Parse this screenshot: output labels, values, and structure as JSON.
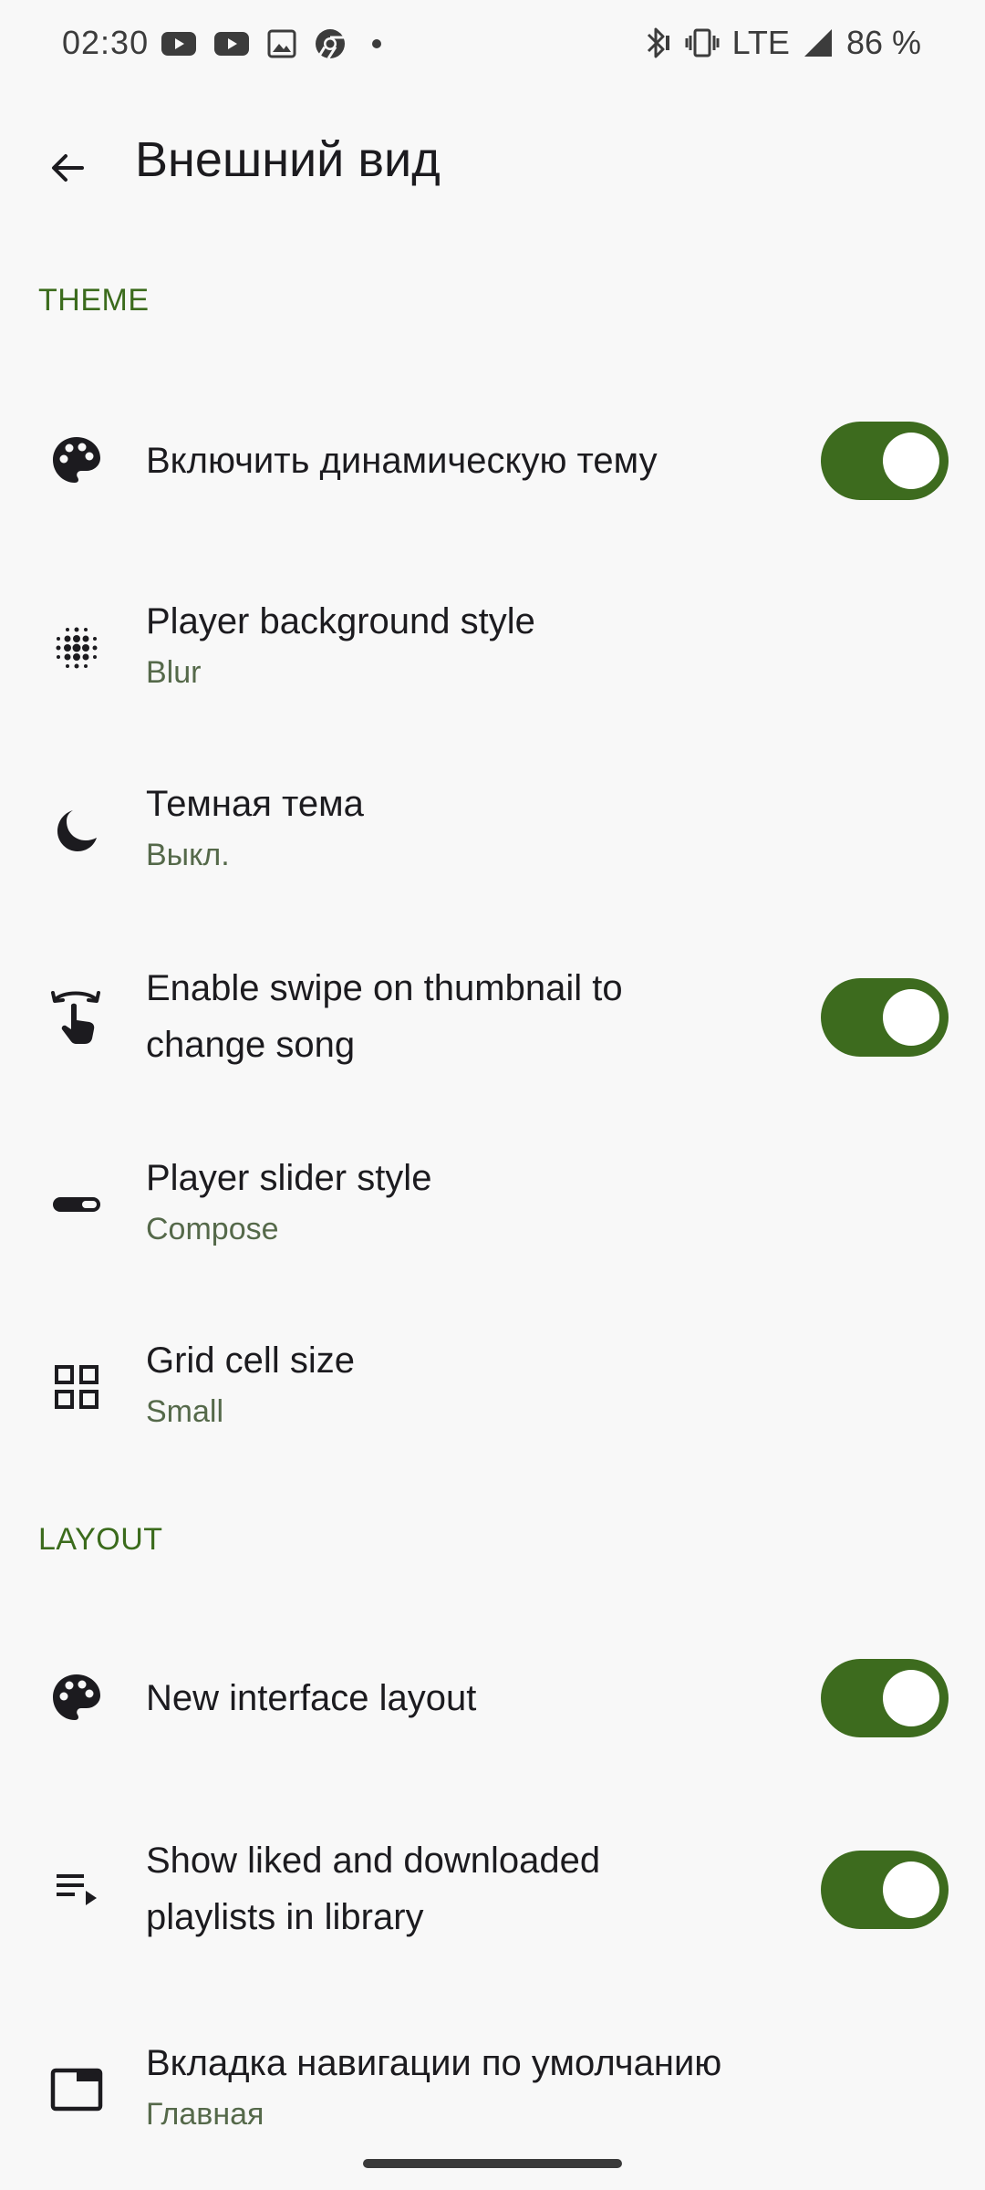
{
  "status_bar": {
    "time": "02:30",
    "network": "LTE",
    "battery": "86 %",
    "left_icons": [
      "youtube-icon",
      "youtube-icon",
      "image-icon",
      "chrome-icon",
      "dot-icon"
    ],
    "right_icons": [
      "bluetooth-icon",
      "vibrate-icon",
      "signal-icon"
    ]
  },
  "app_bar": {
    "title": "Внешний вид"
  },
  "sections": {
    "theme": "THEME",
    "layout": "LAYOUT"
  },
  "items": {
    "dynamic_theme": {
      "title": "Включить динамическую тему",
      "enabled": true,
      "icon": "palette-icon"
    },
    "player_bg": {
      "title": "Player background style",
      "value": "Blur",
      "icon": "blur-icon"
    },
    "dark_theme": {
      "title": "Темная тема",
      "value": "Выкл.",
      "icon": "moon-icon"
    },
    "swipe_thumbnail": {
      "title_line1": "Enable swipe on thumbnail to",
      "title_line2": "change song",
      "enabled": true,
      "icon": "swipe-gesture-icon"
    },
    "slider_style": {
      "title": "Player slider style",
      "value": "Compose",
      "icon": "slider-icon"
    },
    "grid_size": {
      "title": "Grid cell size",
      "value": "Small",
      "icon": "grid-icon"
    },
    "new_layout": {
      "title": "New interface layout",
      "enabled": true,
      "icon": "palette-icon"
    },
    "liked_playlists": {
      "title_line1": "Show liked and downloaded",
      "title_line2": "playlists in library",
      "enabled": true,
      "icon": "playlist-play-icon"
    },
    "default_tab": {
      "title": "Вкладка навигации по умолчанию",
      "value": "Главная",
      "icon": "tab-icon"
    }
  },
  "colors": {
    "accent": "#3d6b1e",
    "section_header": "#3b6b1c",
    "subtitle": "#55694a",
    "background": "#f8f8f8"
  }
}
